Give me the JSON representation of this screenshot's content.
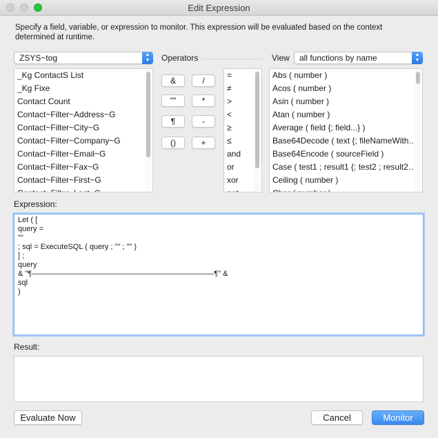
{
  "window": {
    "title": "Edit Expression"
  },
  "instructions": "Specify a field, variable, or expression to monitor. This expression will be evaluated based on the context determined at runtime.",
  "table_select": {
    "value": "ZSYS~tog"
  },
  "operators_label": "Operators",
  "view_label": "View",
  "view_select": {
    "value": "all functions by name"
  },
  "fields": [
    "_Kg ContactS List",
    "_Kg Fixe",
    "Contact Count",
    "Contact~Filter~Address~G",
    "Contact~Filter~City~G",
    "Contact~Filter~Company~G",
    "Contact~Filter~Email~G",
    "Contact~Filter~Fax~G",
    "Contact~Filter~First~G",
    "Contact~Filter~Last~G"
  ],
  "operator_buttons": [
    "&",
    "/",
    "\"\"",
    "*",
    "¶",
    "-",
    "()",
    "+"
  ],
  "comparison_ops": [
    "=",
    "≠",
    ">",
    "<",
    "≥",
    "≤",
    "and",
    "or",
    "xor",
    "not"
  ],
  "functions": [
    "Abs ( number )",
    "Acos ( number )",
    "Asin ( number )",
    "Atan ( number )",
    "Average ( field {; field...} )",
    "Base64Decode ( text {; fileNameWith…",
    "Base64Encode ( sourceField )",
    "Case ( test1 ; result1 {; test2 ; result2…",
    "Ceiling ( number )",
    "Char ( number )"
  ],
  "expression_label": "Expression:",
  "expression_lines": [
    "Let ( [",
    "query =",
    "\"\"",
    "; sql = ExecuteSQL ( query ; \"\" ; \"\" )",
    "] ;",
    "query",
    "& \"¶————————————————————————¶\" &",
    "sql",
    ")"
  ],
  "result_label": "Result:",
  "buttons": {
    "evaluate": "Evaluate Now",
    "cancel": "Cancel",
    "monitor": "Monitor"
  },
  "colors": {
    "accent": "#3a89ef",
    "focus_ring": "#a9cbf5",
    "traffic_green": "#2dc240"
  }
}
